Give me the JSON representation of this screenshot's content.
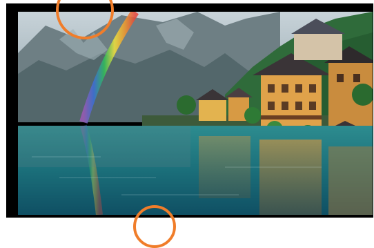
{
  "scene": {
    "subject": "alpine-lakeside-village",
    "colors": {
      "frame": "#000000",
      "marker": "#f07d2a",
      "sky": "#b9c6cf",
      "mountain": "#5f6f73",
      "forest": "#2f6b3a",
      "lake": "#1f7f86",
      "house_wall": "#e0a24a",
      "roof": "#3a3437"
    }
  },
  "markers": [
    {
      "name": "marker-top"
    },
    {
      "name": "marker-bottom"
    }
  ]
}
